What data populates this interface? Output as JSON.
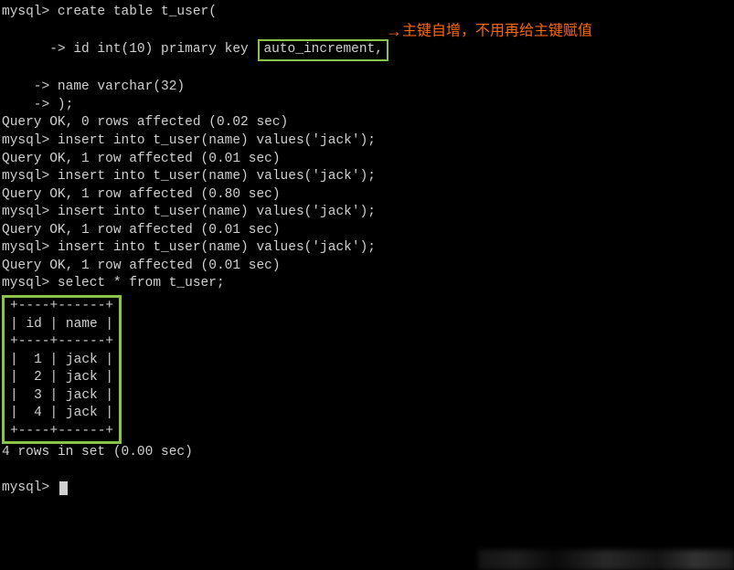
{
  "lines": {
    "l1a": "mysql> create table t_user(",
    "l2a": "    -> id int(10) primary key",
    "l2b": "auto_increment,",
    "l3": "    -> name varchar(32)",
    "l4": "    -> );",
    "l5": "Query OK, 0 rows affected (0.02 sec)",
    "l6": "",
    "l7": "mysql> insert into t_user(name) values('jack');",
    "l8": "Query OK, 1 row affected (0.01 sec)",
    "l9": "",
    "l10": "mysql> insert into t_user(name) values('jack');",
    "l11": "Query OK, 1 row affected (0.80 sec)",
    "l12": "",
    "l13": "mysql> insert into t_user(name) values('jack');",
    "l14": "Query OK, 1 row affected (0.01 sec)",
    "l15": "",
    "l16": "mysql> insert into t_user(name) values('jack');",
    "l17": "Query OK, 1 row affected (0.01 sec)",
    "l18": "",
    "l19": "mysql> select * from t_user;",
    "t_border": "+----+------+",
    "t_header": "| id | name |",
    "t_row1": "|  1 | jack |",
    "t_row2": "|  2 | jack |",
    "t_row3": "|  3 | jack |",
    "t_row4": "|  4 | jack |",
    "l_result": "4 rows in set (0.00 sec)",
    "l_blank": "",
    "l_prompt": "mysql> "
  },
  "annotation": {
    "arrow": "→",
    "text": "主键自增，不用再给主键赋值"
  }
}
